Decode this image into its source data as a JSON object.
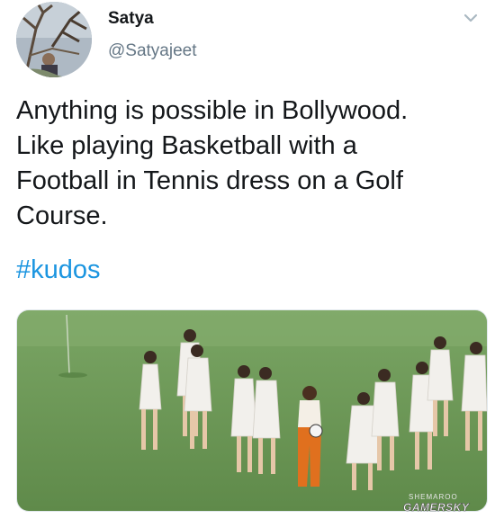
{
  "tweet": {
    "author": {
      "display_name": "Satya",
      "handle": "@Satyajeet"
    },
    "text_lines": [
      "Anything is possible in Bollywood.",
      "Like playing Basketball with a",
      "Football in Tennis dress on a Golf",
      "Course."
    ],
    "hashtag": "#kudos",
    "menu_icon": "chevron-down-icon"
  },
  "media": {
    "description_icon": "photo",
    "watermark_small": "SHEMAROO",
    "watermark": "GAMERSKY"
  },
  "colors": {
    "text": "#14171a",
    "secondary": "#657786",
    "link": "#1b95e0",
    "grass": "#6f9a58"
  }
}
